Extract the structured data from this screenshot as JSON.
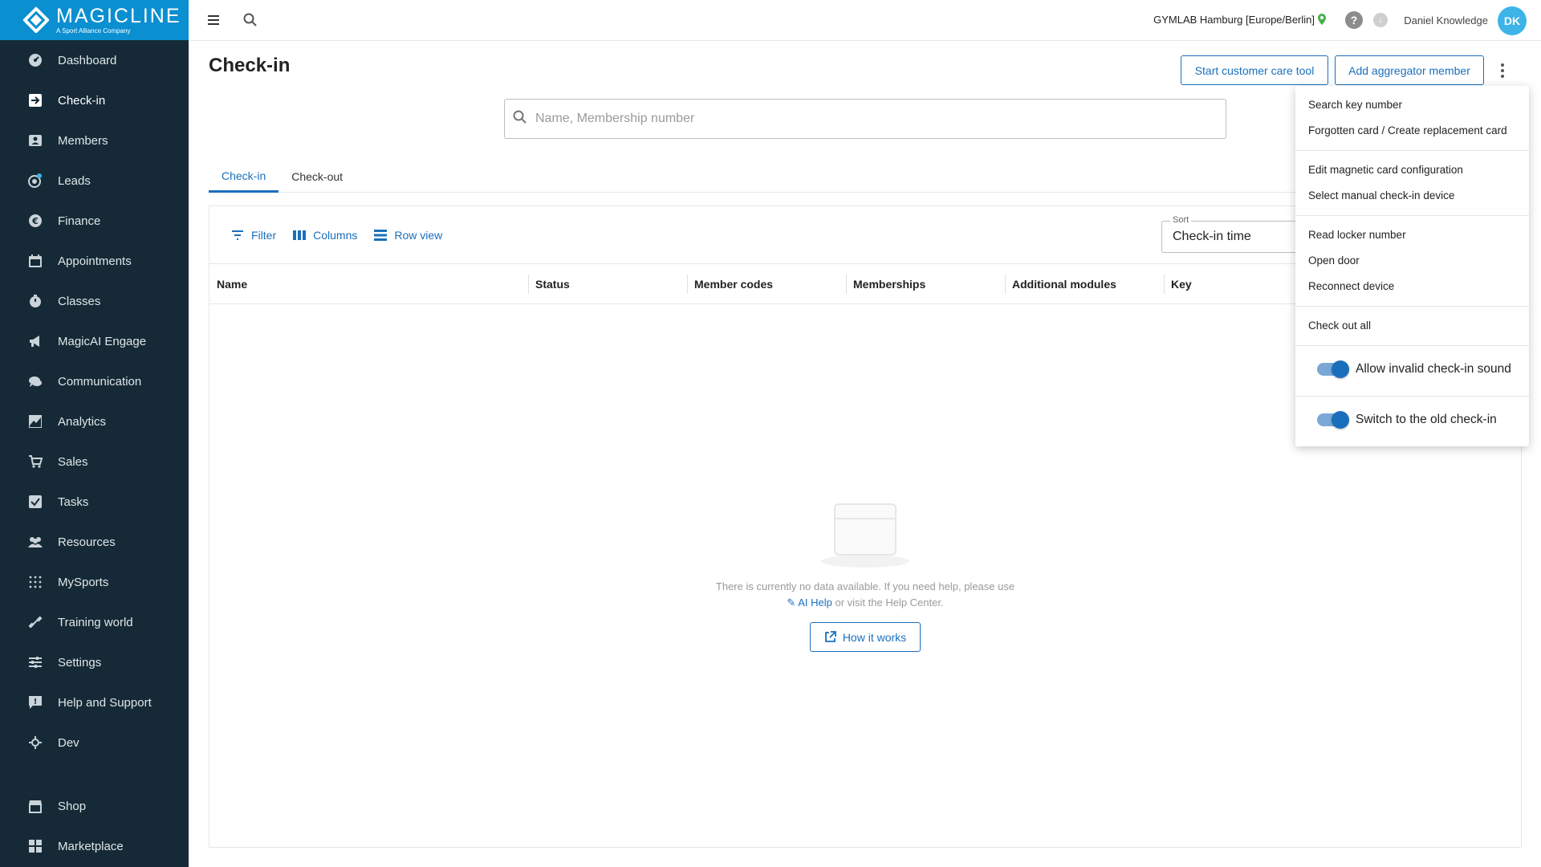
{
  "brand": {
    "name": "MAGICLINE",
    "subtitle": "A Sport Alliance Company"
  },
  "sidebar": {
    "items": [
      {
        "label": "Dashboard",
        "icon": "dashboard-icon"
      },
      {
        "label": "Check-in",
        "icon": "login-icon",
        "active": true
      },
      {
        "label": "Members",
        "icon": "members-icon"
      },
      {
        "label": "Leads",
        "icon": "leads-icon"
      },
      {
        "label": "Finance",
        "icon": "euro-icon"
      },
      {
        "label": "Appointments",
        "icon": "calendar-icon"
      },
      {
        "label": "Classes",
        "icon": "timer-icon"
      },
      {
        "label": "MagicAI Engage",
        "icon": "megaphone-icon"
      },
      {
        "label": "Communication",
        "icon": "chat-icon"
      },
      {
        "label": "Analytics",
        "icon": "chart-icon"
      },
      {
        "label": "Sales",
        "icon": "cart-icon"
      },
      {
        "label": "Tasks",
        "icon": "checkbox-icon"
      },
      {
        "label": "Resources",
        "icon": "group-icon"
      },
      {
        "label": "MySports",
        "icon": "dots-grid-icon"
      },
      {
        "label": "Training world",
        "icon": "dumbbell-icon"
      },
      {
        "label": "Settings",
        "icon": "sliders-icon"
      },
      {
        "label": "Help and Support",
        "icon": "help-chat-icon"
      },
      {
        "label": "Dev",
        "icon": "dev-icon"
      }
    ],
    "bottom_items": [
      {
        "label": "Shop",
        "icon": "shop-icon"
      },
      {
        "label": "Marketplace",
        "icon": "grid-icon"
      }
    ]
  },
  "topbar": {
    "location": "GYMLAB Hamburg [Europe/Berlin]",
    "user_name": "Daniel Knowledge",
    "avatar_initials": "DK"
  },
  "page": {
    "title": "Check-in",
    "start_care_label": "Start customer care tool",
    "add_aggregator_label": "Add aggregator member",
    "search_placeholder": "Name, Membership number"
  },
  "tabs": [
    {
      "label": "Check-in",
      "active": true
    },
    {
      "label": "Check-out",
      "active": false
    }
  ],
  "toolbar": {
    "filter_label": "Filter",
    "columns_label": "Columns",
    "rowview_label": "Row view",
    "sort_label": "Sort",
    "sort_value": "Check-in time"
  },
  "table": {
    "columns": [
      "Name",
      "Status",
      "Member codes",
      "Memberships",
      "Additional modules",
      "Key"
    ]
  },
  "empty_state": {
    "line1": "There is currently no data available. If you need help, please use",
    "ai_help": "AI Help",
    "line2_suffix": " or visit the Help Center.",
    "how_label": "How it works"
  },
  "menu": {
    "group1": [
      "Search key number",
      "Forgotten card / Create replacement card"
    ],
    "group2": [
      "Edit magnetic card configuration",
      "Select manual check-in device"
    ],
    "group3": [
      "Read locker number",
      "Open door",
      "Reconnect device"
    ],
    "group4": [
      "Check out all"
    ],
    "toggle1_label": "Allow invalid check-in sound",
    "toggle1_on": true,
    "toggle2_label": "Switch to the old check-in",
    "toggle2_on": true
  },
  "colors": {
    "sidebar_bg": "#152a36",
    "brand_bg": "#0a8fd1",
    "accent": "#1a6fbd",
    "avatar": "#3db3e8"
  }
}
